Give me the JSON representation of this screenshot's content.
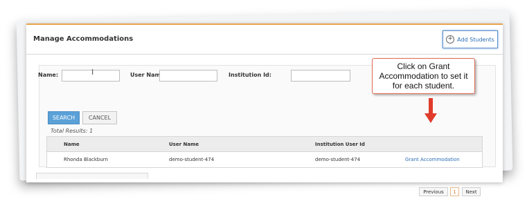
{
  "panel": {
    "title": "Manage Accommodations",
    "add_students_label": "Add Students"
  },
  "search": {
    "name_label": "Name:",
    "name_value": "",
    "user_name_label": "User Name:",
    "user_name_value": "",
    "institution_id_label": "Institution Id:",
    "institution_id_value": "",
    "search_button": "SEARCH",
    "cancel_button": "CANCEL"
  },
  "results": {
    "total_text": "Total Results: 1",
    "columns": [
      "Name",
      "User Name",
      "Institution User Id"
    ],
    "rows": [
      {
        "name": "Rhonda Blackburn",
        "user_name": "demo-student-474",
        "institution_user_id": "demo-student-474",
        "action": "Grant Accommodation"
      }
    ]
  },
  "pagination": {
    "previous": "Previous",
    "current_page": "1",
    "next": "Next"
  },
  "callout": {
    "text": "Click on Grant Accommodation to set it for each student."
  },
  "colors": {
    "accent_orange": "#e8a44b",
    "link_blue": "#2a6db4",
    "search_button": "#5ba1d8",
    "arrow_red": "#e03c2c"
  },
  "icons": {
    "add": "plus-circle-icon",
    "cursor": "text-cursor-icon",
    "arrow": "arrow-down-icon"
  }
}
